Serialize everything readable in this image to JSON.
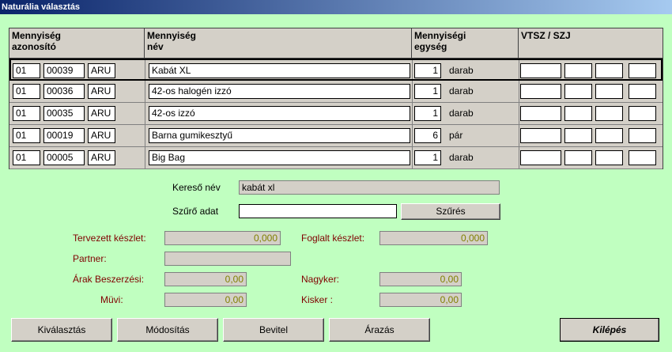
{
  "window": {
    "title": "Naturália választás"
  },
  "grid": {
    "headers": {
      "id_line1": "Mennyiség",
      "id_line2": "azonosító",
      "name_line1": "Mennyiség",
      "name_line2": "név",
      "unit_line1": "Mennyiségi",
      "unit_line2": "egység",
      "vtsz": "VTSZ / SZJ"
    },
    "rows": [
      {
        "c1": "01",
        "c2": "00039",
        "c3": "ARU",
        "name": "Kabát XL",
        "qty": "1",
        "unit": "darab"
      },
      {
        "c1": "01",
        "c2": "00036",
        "c3": "ARU",
        "name": "42-os halogén izzó",
        "qty": "1",
        "unit": "darab"
      },
      {
        "c1": "01",
        "c2": "00035",
        "c3": "ARU",
        "name": "42-os izzó",
        "qty": "1",
        "unit": "darab"
      },
      {
        "c1": "01",
        "c2": "00019",
        "c3": "ARU",
        "name": "Barna gumikesztyű",
        "qty": "6",
        "unit": "pár"
      },
      {
        "c1": "01",
        "c2": "00005",
        "c3": "ARU",
        "name": "Big Bag",
        "qty": "1",
        "unit": "darab"
      }
    ]
  },
  "search": {
    "label": "Kereső név",
    "value": "kabát xl",
    "filter_label": "Szűrő adat",
    "filter_value": "",
    "filter_button": "Szűrés"
  },
  "info": {
    "planned_label": "Tervezett készlet:",
    "planned_value": "0,000",
    "reserved_label": "Foglalt készlet:",
    "reserved_value": "0,000",
    "partner_label": "Partner:",
    "partner_value": "",
    "price_purchase_label": "Árak Beszerzési:",
    "price_purchase_value": "0,00",
    "wholesale_label": "Nagyker:",
    "wholesale_value": "0,00",
    "muvi_label": "Müvi:",
    "muvi_value": "0,00",
    "retail_label": "Kisker :",
    "retail_value": "0,00"
  },
  "buttons": {
    "select": "Kiválasztás",
    "modify": "Módosítás",
    "input": "Bevitel",
    "pricing": "Árazás",
    "exit": "Kilépés"
  }
}
